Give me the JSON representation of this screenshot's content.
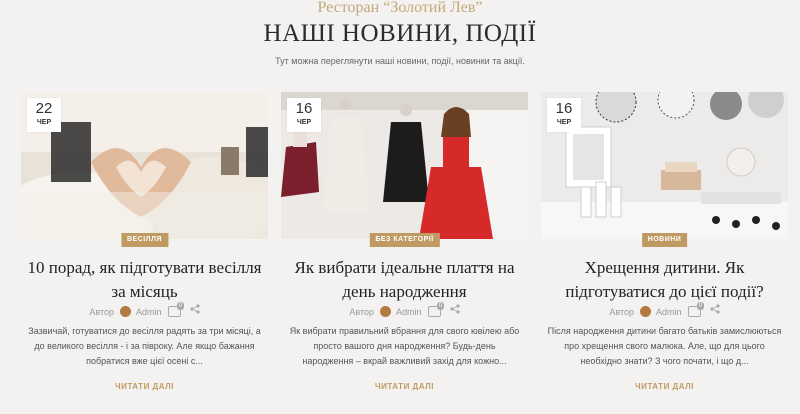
{
  "header": {
    "restaurant": "Ресторан “Золотий Лев”",
    "title": "НАШІ НОВИНИ, ПОДІЇ",
    "subtitle": "Тут можна переглянути наші новини, події, новинки та акції."
  },
  "posts": [
    {
      "day": "22",
      "month": "ЧЕР",
      "category": "ВЕСІЛЛЯ",
      "title": "10 порад, як підготувати весілля за місяць",
      "author_label": "Автор",
      "author": "Admin",
      "comments": "0",
      "excerpt": "Зазвичай, готуватися до весілля радять за три місяці, а до великого весілля - і за півроку. Але якщо бажання побратися вже цієї осені с...",
      "read_more": "ЧИТАТИ ДАЛІ"
    },
    {
      "day": "16",
      "month": "ЧЕР",
      "category": "БЕЗ КАТЕГОРІЇ",
      "title": "Як вибрати ідеальне плаття на день народження",
      "author_label": "Автор",
      "author": "Admin",
      "comments": "0",
      "excerpt": "Як вибрати правильний вбрання для свого ювілею або просто вашого дня народження? Будь-день народження – вкрай важливий захід для кожно...",
      "read_more": "ЧИТАТИ ДАЛІ"
    },
    {
      "day": "16",
      "month": "ЧЕР",
      "category": "НОВИНИ",
      "title": "Хрещення дитини. Як підготуватися до цієї події?",
      "author_label": "Автор",
      "author": "Admin",
      "comments": "0",
      "excerpt": "Після народження дитини багато батьків замислюються про хрещення свого малюка. Але, що для цього необхідно знати? З чого почати, і що д...",
      "read_more": "ЧИТАТИ ДАЛІ"
    }
  ],
  "colors": {
    "accent": "#c09a63",
    "gold_title": "#c2a97a",
    "background": "#f3f2f0"
  }
}
